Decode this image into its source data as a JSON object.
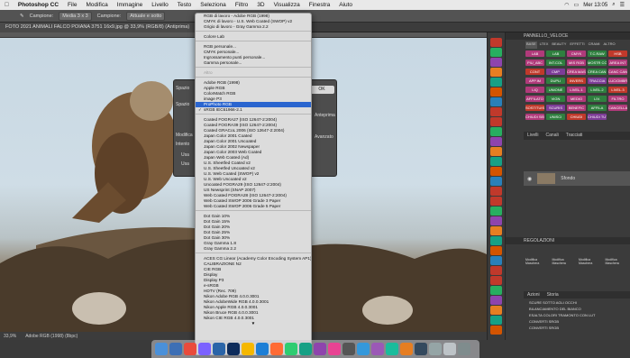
{
  "menubar": {
    "apple": "",
    "app": "Photoshop CC",
    "items": [
      "File",
      "Modifica",
      "Immagine",
      "Livello",
      "Testo",
      "Seleziona",
      "Filtro",
      "3D",
      "Visualizza",
      "Finestra",
      "Aiuto"
    ],
    "clock": "Mer 13:05",
    "window_title": "Adobe Photoshop CC 2018"
  },
  "options": {
    "campione_label": "Campione:",
    "campione_value": "Media 3 x 3",
    "campione2_label": "Campione:",
    "campione2_value": "Attuale e sotto"
  },
  "document": {
    "tab": "FOTO 2021 ANIMALI FALCO POIANA 3751 16x9.jpg @ 33,9% (RGB/8) (Antiprima)",
    "zoom": "33,9%",
    "profile": "Adobe RGB (1998) (8bpc)"
  },
  "dialog": {
    "label_spazio": "Spazio",
    "label_modo": "Modifica",
    "label_intento": "Intento",
    "ok": "OK",
    "annulla": "Annulla",
    "antiprima": "Anteprima",
    "avanzato": "Avanzato",
    "usa1": "Usa",
    "usa2": "Usa"
  },
  "menu": {
    "groups": [
      [
        "RGB di lavoro - Adobe RGB (1998)",
        "CMYK di lavoro - U.S. Web Coated (SWOP) v2",
        "Grigio di lavoro - Gray Gamma 2.2"
      ],
      [
        "Colore Lab"
      ],
      [
        "RGB personale...",
        "CMYK personale...",
        "Ingrossamento punti personale...",
        "Gamma personale..."
      ],
      [
        "Altro"
      ],
      [
        "Adobe RGB (1998)",
        "Apple RGB",
        "ColorMatch RGB",
        "image P3",
        "ProPhoto RGB",
        "sRGB IEC61966-2.1"
      ],
      [
        "Coated FOGRA27 (ISO 12647-2:2004)",
        "Coated FOGRA39 (ISO 12647-2:2004)",
        "Coated GRACoL 2006 (ISO 12647-2:2004)",
        "Japan Color 2001 Coated",
        "Japan Color 2001 Uncoated",
        "Japan Color 2002 Newspaper",
        "Japan Color 2003 Web Coated",
        "Japan Web Coated (Ad)",
        "U.S. Sheetfed Coated v2",
        "U.S. Sheetfed Uncoated v2",
        "U.S. Web Coated (SWOP) v2",
        "U.S. Web Uncoated v2",
        "Uncoated FOGRA29 (ISO 12647-2:2004)",
        "US Newsprint (SNAP 2007)",
        "Web Coated FOGRA28 (ISO 12647-2:2004)",
        "Web Coated SWOP 2006 Grade 3 Paper",
        "Web Coated SWOP 2006 Grade 5 Paper"
      ],
      [
        "Dot Gain 10%",
        "Dot Gain 15%",
        "Dot Gain 20%",
        "Dot Gain 25%",
        "Dot Gain 30%",
        "Gray Gamma 1.8",
        "Gray Gamma 2.2"
      ],
      [
        "ACES CG Linear (Academy Color Encoding System AP1)",
        "CALIBRAZIONE N2",
        "CIE RGB",
        "Display",
        "Display P3",
        "e-sRGB",
        "HDTV (Rec. 709)",
        "Nikon Adobe RGB 4.0.0.3001",
        "Nikon AdobeWide RGB 4.0.0.3001",
        "Nikon Apple RGB 4.0.0.3001",
        "Nikon Bruce RGB 4.0.0.3001",
        "Nikon CIE RGB 4.0.0.3001"
      ]
    ],
    "highlighted": "ProPhoto RGB",
    "checked": "sRGB IEC61966-2.1",
    "more_arrow": "▼"
  },
  "panels": {
    "pannello_title": "PANNELLO_VELOCE",
    "tabs": [
      "BASE",
      "LTEX",
      "BEAUTY",
      "EFFETTI",
      "CRAMI",
      "ALTRO"
    ],
    "buttons": [
      "LAB",
      "LAB",
      "CMYK",
      "T.C.RAW",
      "HSB",
      "PIU_ABC",
      "INT.COL",
      "MIS RGB",
      "MOSTR COLO",
      "AREA INT",
      "CONT",
      "CMP",
      "CREA MASK",
      "CREA CAN ALT",
      "CANC CAN",
      "APP.IM",
      "DUPLI",
      "INVERS",
      "TRACCIA",
      "LUC/OMBRA",
      "LIQ",
      "UNIONE",
      "LIVEL.1",
      "LIVEL.2",
      "LIVEL.3",
      "AFFILATO",
      "VIGN",
      "MEDIO",
      "LIV.",
      "FILTRO",
      "SOSTITUIS",
      "SCURIS",
      "BENEFIC",
      "AFFILA",
      "CANCELLAZ",
      "CHIUDI SELEZ",
      "UNISCI",
      "CHIUDI",
      "CHIUDI TUTTO"
    ],
    "layers_tabs": [
      "Livelli",
      "Canali",
      "Tracciati"
    ],
    "layer_name": "Sfondo",
    "regolazioni": "REGOLAZIONI",
    "adj": [
      "Modifica Maschera",
      "Modifica Maschera",
      "Modifica Maschera",
      "Modifica Maschera"
    ],
    "azioni_tabs": [
      "Azioni",
      "Storia"
    ],
    "azioni": [
      "SCURE SOTTO AGLI OCCHI",
      "BILANCIAMENTO DEL BIANCO",
      "ESALTA COLORI TRAMONTO CON LUT",
      "CONVERTI SRGB",
      "CONVERTI SRGB"
    ]
  },
  "colors": {
    "highlight": "#2a65cf",
    "menu_bg": "#dcdcdc"
  }
}
